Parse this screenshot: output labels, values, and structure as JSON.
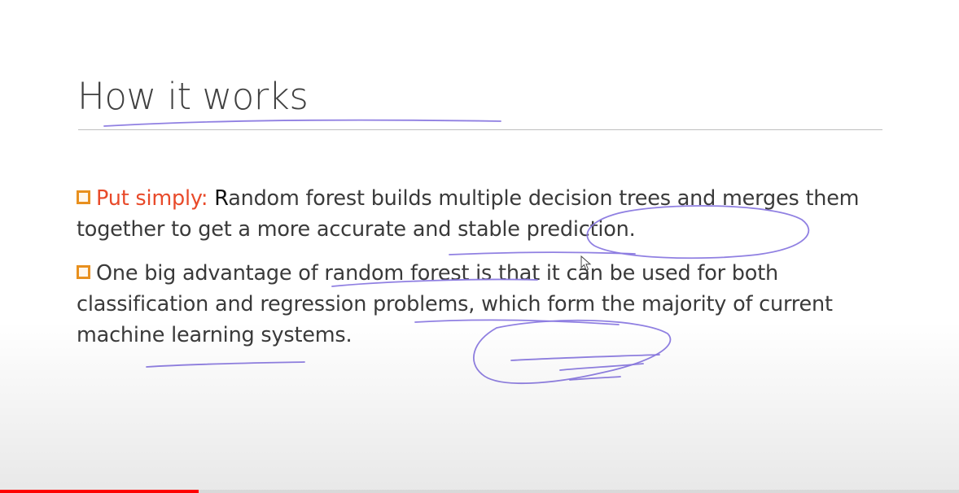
{
  "slide": {
    "title": "How it works",
    "bullets": [
      {
        "lead": "Put simply:",
        "lead_first_char": " R",
        "text": "andom forest builds multiple decision trees and merges them together to get a more accurate and stable prediction."
      },
      {
        "text": "One big advantage of random forest is that it can be used for both classification and regression problems, which form the majority of current machine learning systems."
      }
    ]
  },
  "video": {
    "progress_fraction": 0.207
  },
  "colors": {
    "lead_text": "#e84a2a",
    "bullet_marker": "#e8901e",
    "ink": "#8a79e0",
    "progress": "#ff0000"
  }
}
